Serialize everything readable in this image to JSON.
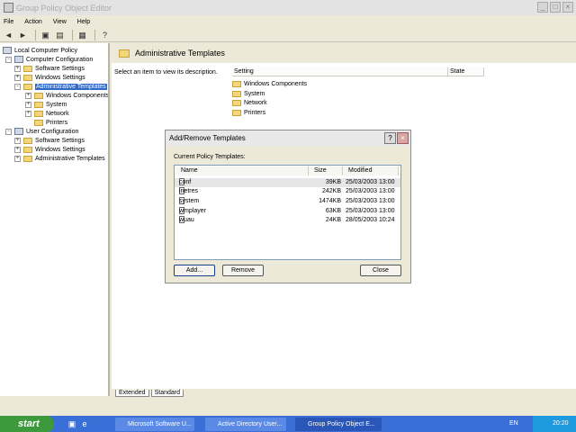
{
  "window": {
    "title": "Group Policy Object Editor"
  },
  "menu": [
    "File",
    "Action",
    "View",
    "Help"
  ],
  "tree": {
    "root": "Local Computer Policy",
    "computer_config": "Computer Configuration",
    "cc_software": "Software Settings",
    "cc_windows": "Windows Settings",
    "cc_admin": "Administrative Templates",
    "cc_wc": "Windows Components",
    "cc_system": "System",
    "cc_network": "Network",
    "cc_printers": "Printers",
    "user_config": "User Configuration",
    "uc_software": "Software Settings",
    "uc_windows": "Windows Settings",
    "uc_admin": "Administrative Templates"
  },
  "right": {
    "heading": "Administrative Templates",
    "description": "Select an item to view its description.",
    "col_setting": "Setting",
    "col_state": "State",
    "items": [
      "Windows Components",
      "System",
      "Network",
      "Printers"
    ]
  },
  "tabs": {
    "extended": "Extended",
    "standard": "Standard"
  },
  "dialog": {
    "title": "Add/Remove Templates",
    "label": "Current Policy Templates:",
    "col_name": "Name",
    "col_size": "Size",
    "col_modified": "Modified",
    "rows": [
      {
        "name": "conf",
        "size": "39KB",
        "modified": "25/03/2003 13:00"
      },
      {
        "name": "inetres",
        "size": "242KB",
        "modified": "25/03/2003 13:00"
      },
      {
        "name": "system",
        "size": "1474KB",
        "modified": "25/03/2003 13:00"
      },
      {
        "name": "wmplayer",
        "size": "63KB",
        "modified": "25/03/2003 13:00"
      },
      {
        "name": "wuau",
        "size": "24KB",
        "modified": "28/05/2003 10:24"
      }
    ],
    "add": "Add...",
    "remove": "Remove",
    "close": "Close"
  },
  "taskbar": {
    "start": "start",
    "tasks": [
      "Microsoft Software U...",
      "Active Directory User...",
      "Group Policy Object E..."
    ],
    "lang": "EN",
    "clock": "20:20"
  }
}
